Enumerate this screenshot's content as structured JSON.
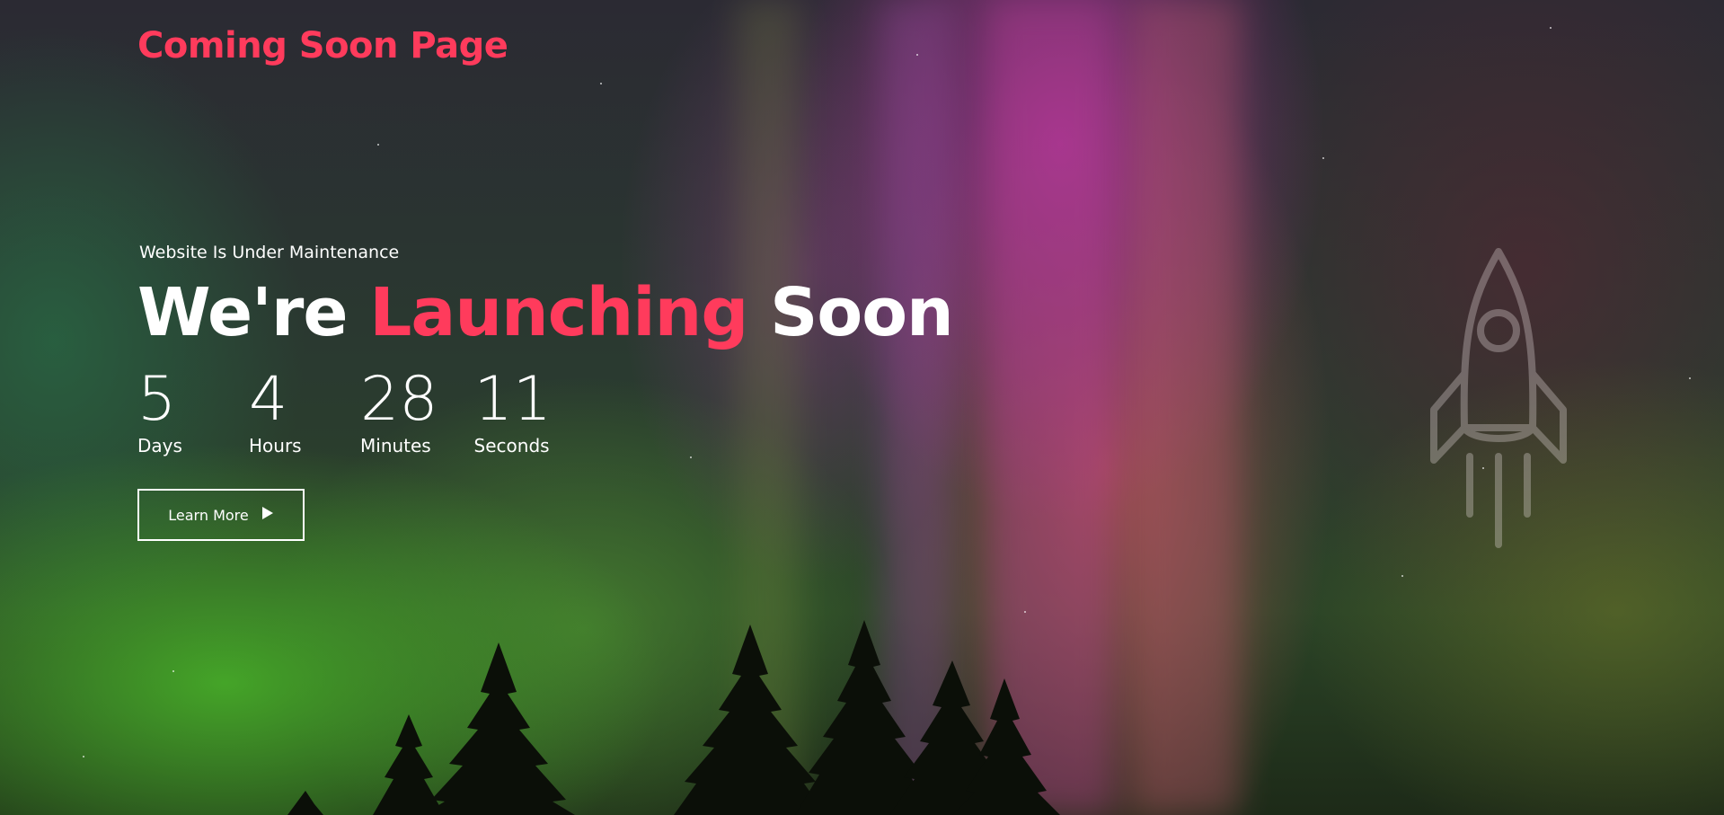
{
  "brand": {
    "title": "Coming Soon Page"
  },
  "hero": {
    "subtitle": "Website Is Under Maintenance",
    "headline_part1": "We're",
    "headline_accent": "Launching",
    "headline_part2": "Soon"
  },
  "countdown": [
    {
      "value": "5",
      "label": "Days"
    },
    {
      "value": "4",
      "label": "Hours"
    },
    {
      "value": "28",
      "label": "Minutes"
    },
    {
      "value": "11",
      "label": "Seconds"
    }
  ],
  "cta": {
    "label": "Learn More",
    "icon": "play-icon"
  },
  "decor": {
    "rocket_icon": "rocket-icon"
  },
  "colors": {
    "accent": "#ff3b5c",
    "text": "#ffffff"
  }
}
